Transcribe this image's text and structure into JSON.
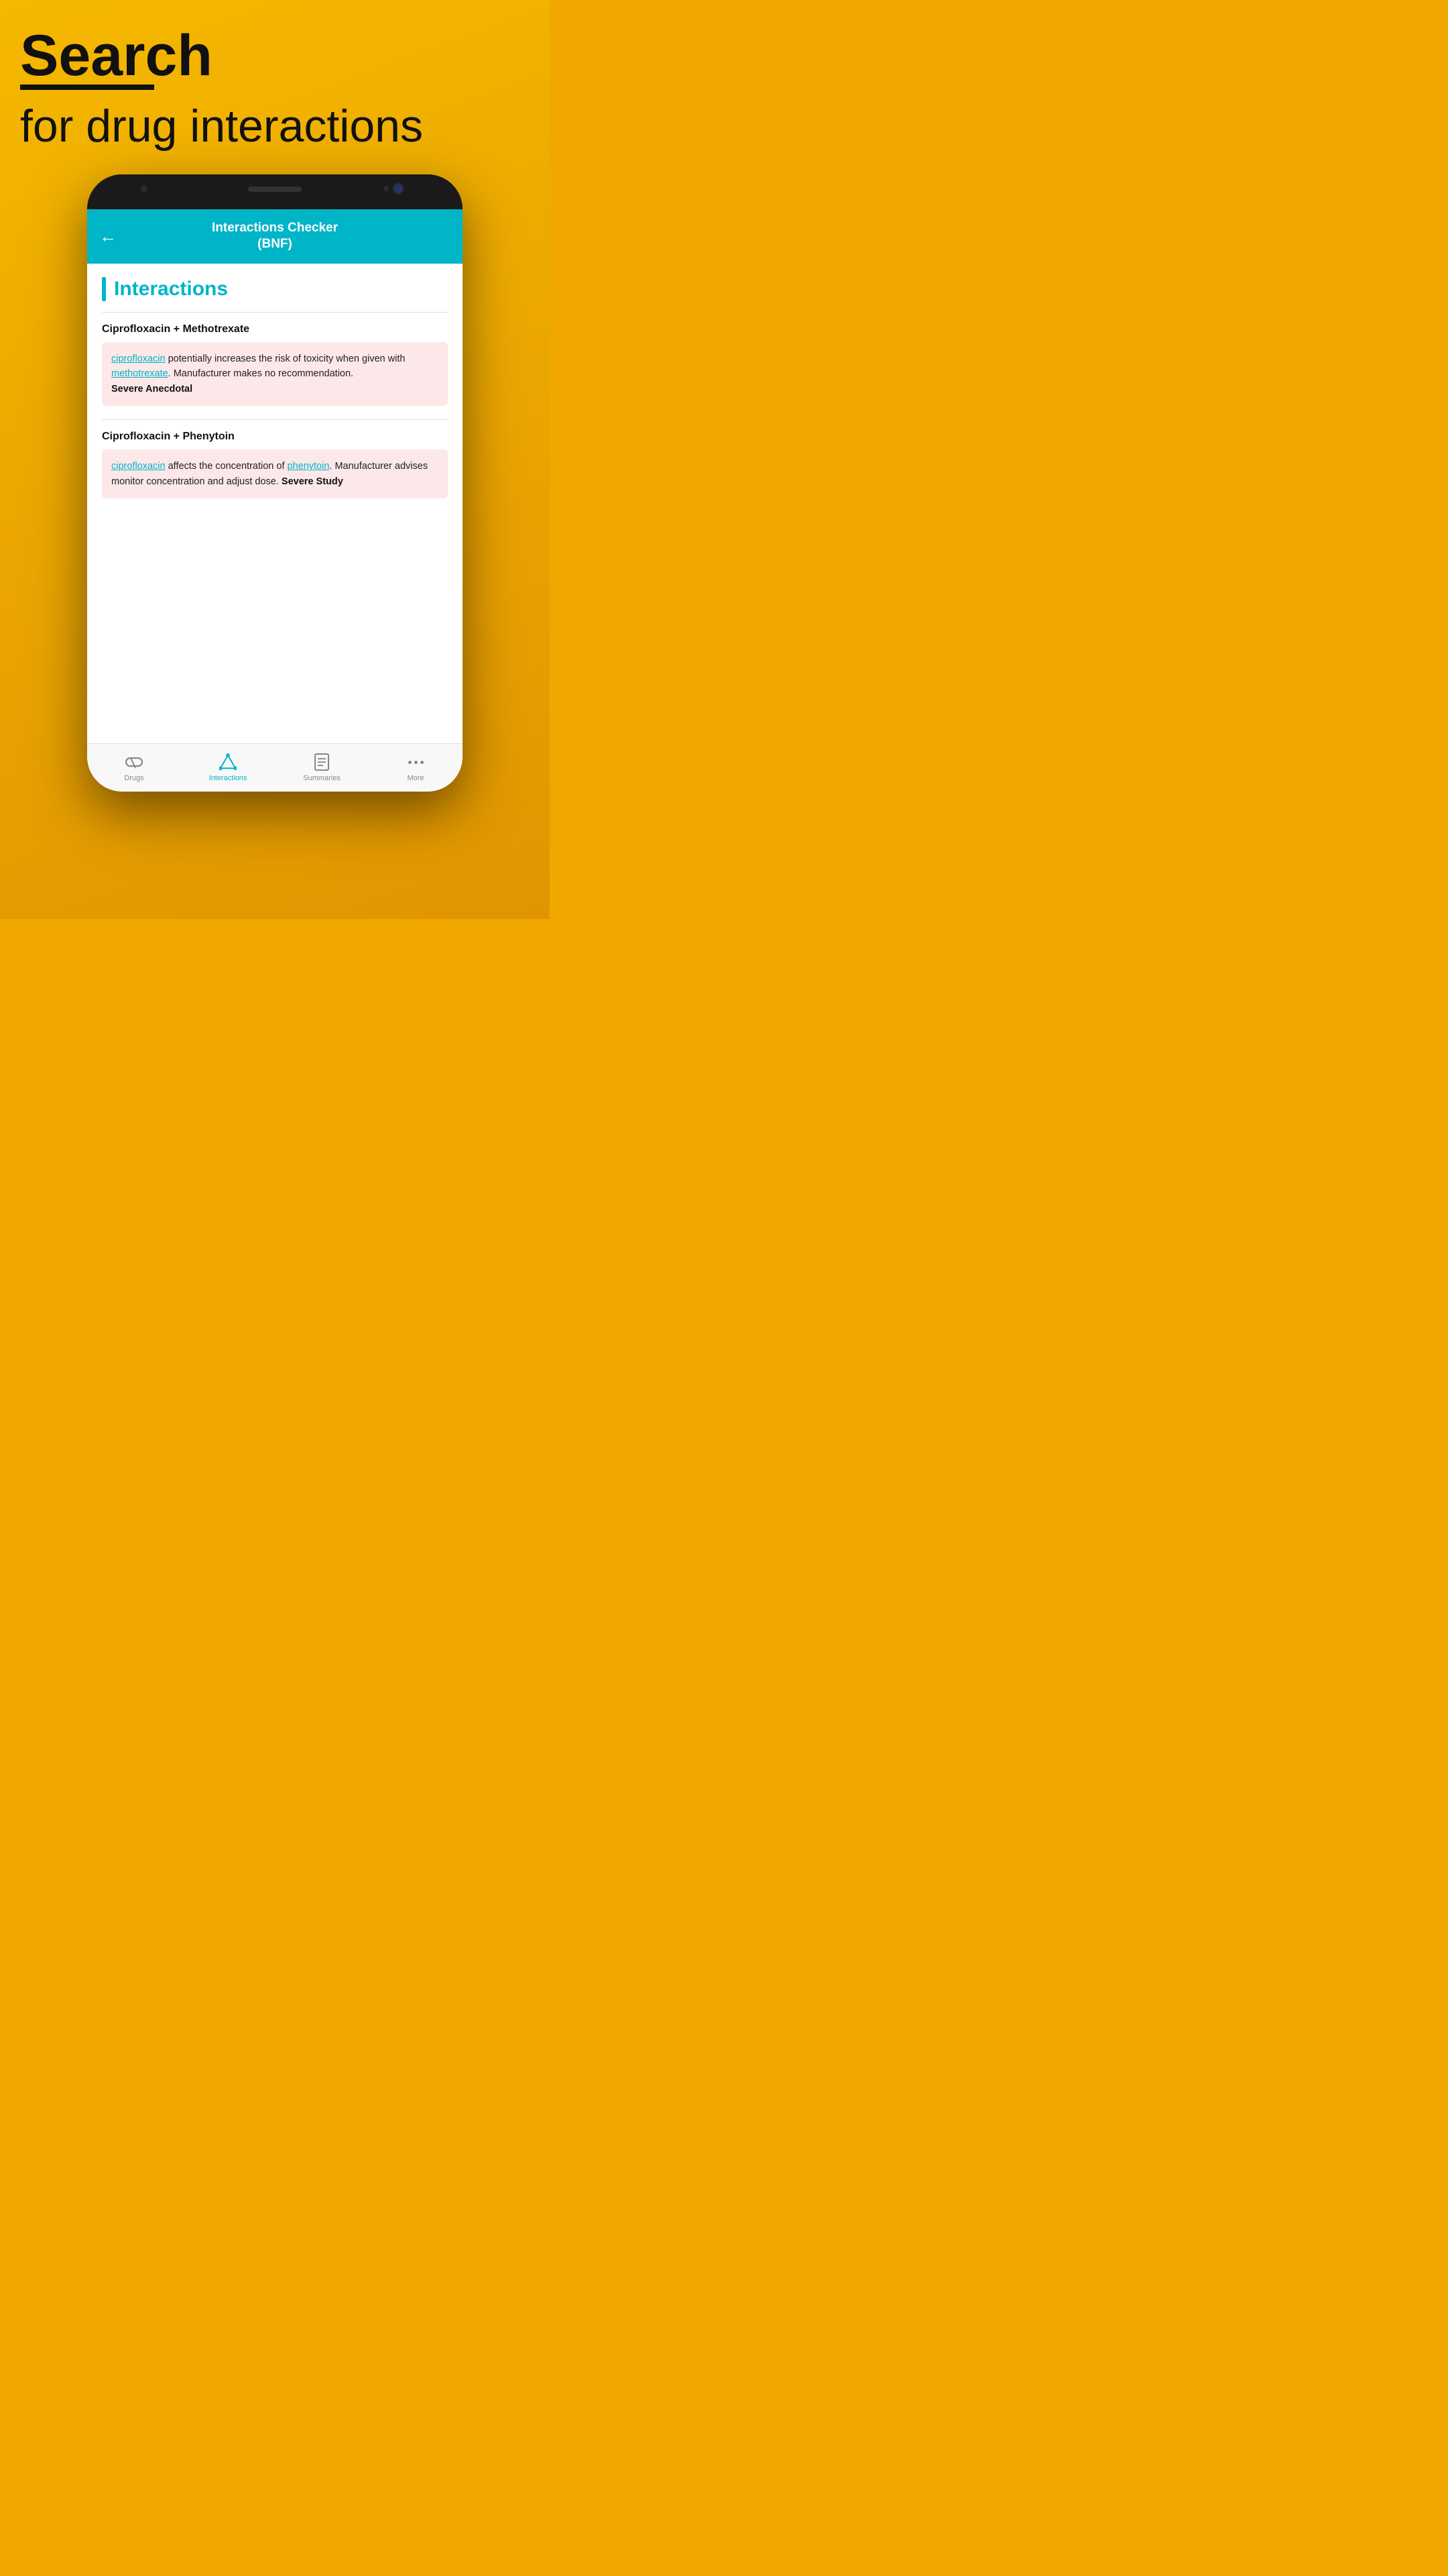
{
  "hero": {
    "search_label": "Search",
    "subtitle": "for drug interactions"
  },
  "app": {
    "header_title": "Interactions Checker",
    "header_subtitle": "(BNF)",
    "back_label": "←",
    "section_title": "Interactions"
  },
  "interactions": [
    {
      "pair_title": "Ciprofloxacin + Methotrexate",
      "drug1": "ciprofloxacin",
      "text_middle": " potentially increases the risk of toxicity when given with ",
      "drug2": "methotrexate",
      "text_end": ". Manufacturer makes no recommendation.",
      "severity": "Severe Anecdotal"
    },
    {
      "pair_title": "Ciprofloxacin + Phenytoin",
      "drug1": "ciprofloxacin",
      "text_middle": " affects the concentration of ",
      "drug2": "phenytoin",
      "text_end": ". Manufacturer advises monitor concentration and adjust dose.",
      "severity": "Severe Study"
    }
  ],
  "bottom_nav": {
    "items": [
      {
        "label": "Drugs",
        "active": false
      },
      {
        "label": "Interactions",
        "active": true
      },
      {
        "label": "Summaries",
        "active": false
      },
      {
        "label": "More",
        "active": false
      }
    ]
  },
  "colors": {
    "teal": "#00B5C8",
    "background_top": "#F5B800",
    "background_bottom": "#E09500"
  }
}
